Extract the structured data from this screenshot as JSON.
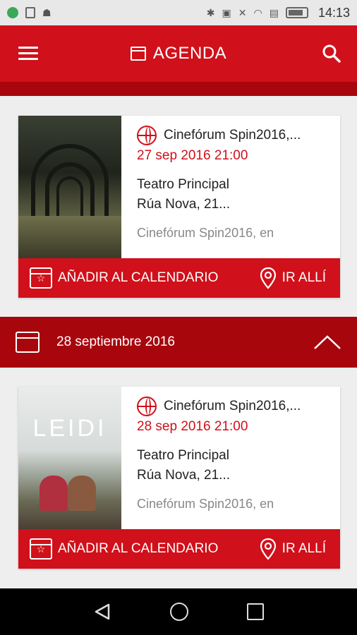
{
  "status_bar": {
    "time": "14:13"
  },
  "app_bar": {
    "title": "AGENDA"
  },
  "date_header": {
    "label": "28 septiembre 2016"
  },
  "events": [
    {
      "title": "Cinefórum Spin2016,...",
      "date": "27 sep 2016 21:00",
      "venue": "Teatro Principal",
      "address": "Rúa Nova, 21...",
      "description": "Cinefórum Spin2016, en",
      "add_label": "AÑADIR AL CALENDARIO",
      "go_label": "IR ALLÍ"
    },
    {
      "title": "Cinefórum Spin2016,...",
      "date": "28 sep 2016 21:00",
      "venue": "Teatro Principal",
      "address": "Rúa Nova, 21...",
      "description": "Cinefórum Spin2016, en",
      "poster_text": "LEIDI",
      "add_label": "AÑADIR AL CALENDARIO",
      "go_label": "IR ALLÍ"
    }
  ],
  "colors": {
    "primary": "#d0101a",
    "header_dark": "#a8060d"
  }
}
